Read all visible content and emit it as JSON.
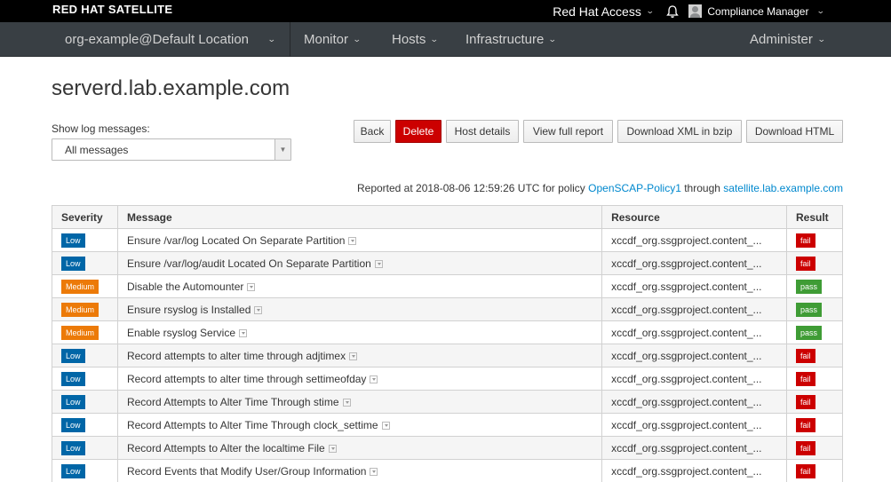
{
  "header": {
    "brand": "RED HAT SATELLITE",
    "red_hat_access": "Red Hat Access",
    "user": "Compliance Manager"
  },
  "nav": {
    "org": "org-example@Default Location",
    "monitor": "Monitor",
    "hosts": "Hosts",
    "infrastructure": "Infrastructure",
    "administer": "Administer"
  },
  "page": {
    "title": "serverd.lab.example.com",
    "filter_label": "Show log messages:",
    "filter_value": "All messages"
  },
  "buttons": {
    "back": "Back",
    "delete": "Delete",
    "host_details": "Host details",
    "view_full_report": "View full report",
    "download_xml": "Download XML in bzip",
    "download_html": "Download HTML"
  },
  "report": {
    "prefix": "Reported at 2018-08-06 12:59:26 UTC for policy",
    "policy": "OpenSCAP-Policy1",
    "through": "through",
    "proxy": "satellite.lab.example.com"
  },
  "table": {
    "headers": [
      "Severity",
      "Message",
      "Resource",
      "Result"
    ],
    "rows": [
      {
        "severity": "Low",
        "message": "Ensure /var/log Located On Separate Partition",
        "resource": "xccdf_org.ssgproject.content_...",
        "result": "fail"
      },
      {
        "severity": "Low",
        "message": "Ensure /var/log/audit Located On Separate Partition",
        "resource": "xccdf_org.ssgproject.content_...",
        "result": "fail"
      },
      {
        "severity": "Medium",
        "message": "Disable the Automounter",
        "resource": "xccdf_org.ssgproject.content_...",
        "result": "pass"
      },
      {
        "severity": "Medium",
        "message": "Ensure rsyslog is Installed",
        "resource": "xccdf_org.ssgproject.content_...",
        "result": "pass"
      },
      {
        "severity": "Medium",
        "message": "Enable rsyslog Service",
        "resource": "xccdf_org.ssgproject.content_...",
        "result": "pass"
      },
      {
        "severity": "Low",
        "message": "Record attempts to alter time through adjtimex",
        "resource": "xccdf_org.ssgproject.content_...",
        "result": "fail"
      },
      {
        "severity": "Low",
        "message": "Record attempts to alter time through settimeofday",
        "resource": "xccdf_org.ssgproject.content_...",
        "result": "fail"
      },
      {
        "severity": "Low",
        "message": "Record Attempts to Alter Time Through stime",
        "resource": "xccdf_org.ssgproject.content_...",
        "result": "fail"
      },
      {
        "severity": "Low",
        "message": "Record Attempts to Alter Time Through clock_settime",
        "resource": "xccdf_org.ssgproject.content_...",
        "result": "fail"
      },
      {
        "severity": "Low",
        "message": "Record Attempts to Alter the localtime File",
        "resource": "xccdf_org.ssgproject.content_...",
        "result": "fail"
      },
      {
        "severity": "Low",
        "message": "Record Events that Modify User/Group Information",
        "resource": "xccdf_org.ssgproject.content_...",
        "result": "fail"
      }
    ]
  },
  "colors": {
    "low": "#0066a7",
    "medium": "#ec7a08",
    "fail": "#cc0000",
    "pass": "#3f9c35",
    "link": "#0088ce"
  }
}
